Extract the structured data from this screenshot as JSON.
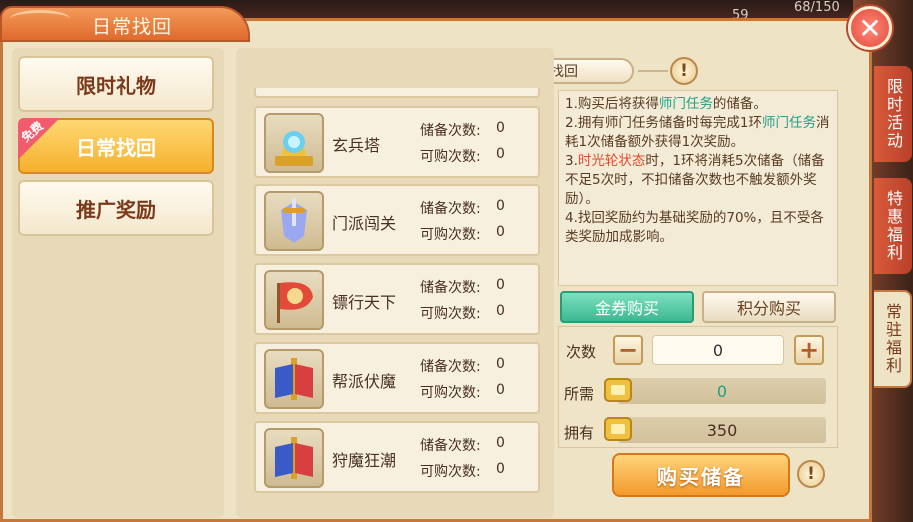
{
  "window": {
    "title": "日常找回",
    "close_icon": "close-icon"
  },
  "hud": {
    "level": "59",
    "counter": "68/150"
  },
  "sidebar": {
    "items": [
      {
        "label": "限时礼物",
        "active": false
      },
      {
        "label": "日常找回",
        "active": true,
        "badge": "免费"
      },
      {
        "label": "推广奖励",
        "active": false
      }
    ]
  },
  "section": {
    "header": "日常找回",
    "info_icon": "exclamation-icon"
  },
  "tasks": {
    "stored_label": "储备次数:",
    "buyable_label": "可购次数:",
    "items": [
      {
        "name": "玄兵塔",
        "stored": "0",
        "buyable": "0",
        "icon": "crystal-shrine-icon"
      },
      {
        "name": "门派闯关",
        "stored": "0",
        "buyable": "0",
        "icon": "sword-shield-icon"
      },
      {
        "name": "镖行天下",
        "stored": "0",
        "buyable": "0",
        "icon": "escort-flag-icon"
      },
      {
        "name": "帮派伏魔",
        "stored": "0",
        "buyable": "0",
        "icon": "scroll-flags-icon"
      },
      {
        "name": "狩魔狂潮",
        "stored": "0",
        "buyable": "0",
        "icon": "scroll-flags-icon"
      }
    ]
  },
  "description": {
    "line1_a": "1.购买后将获得",
    "line1_hl": "师门任务",
    "line1_b": "的储备。",
    "line2_a": "2.拥有师门任务储备时每完成1环",
    "line2_hl": "师门任务",
    "line2_b": "消耗1次储备额外获得1次奖励。",
    "line3_a": "3.",
    "line3_hl": "时光轮状态",
    "line3_b": "时，1环将消耗5次储备（储备不足5次时，不扣储备次数也不触发额外奖励）。",
    "line4": "4.找回奖励约为基础奖励的70%，且不受各类奖励加成影响。"
  },
  "purchase": {
    "tab_gold": "金券购买",
    "tab_points": "积分购买",
    "count_label": "次数",
    "count_value": "0",
    "minus": "−",
    "plus": "+",
    "required_label": "所需",
    "required_value": "0",
    "owned_label": "拥有",
    "owned_value": "350",
    "buy_button": "购买储备",
    "currency_icon": "gold-coupon-icon",
    "colors": {
      "required": "#20a088",
      "tab_active": "#3cb890"
    }
  },
  "side_tabs": [
    {
      "label": "限时活动",
      "active": false
    },
    {
      "label": "特惠福利",
      "active": false
    },
    {
      "label": "常驻福利",
      "active": true
    }
  ]
}
